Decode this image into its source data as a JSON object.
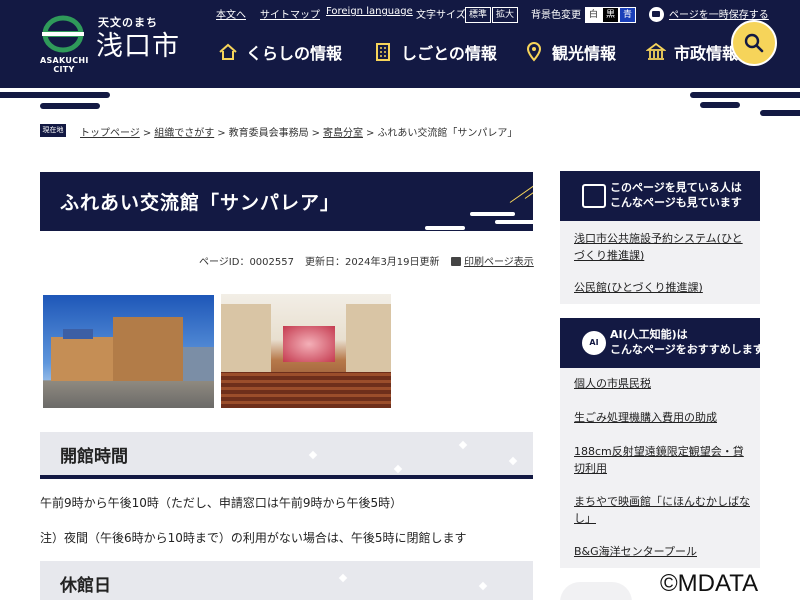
{
  "colors": {
    "navy": "#131943",
    "accent_yellow": "#f6d45a",
    "panel_gray": "#e7e8ed",
    "sidebar_bg": "#f1f1f3"
  },
  "header": {
    "logo": {
      "tagline": "天文のまち",
      "city_jp": "浅口市",
      "city_en": "ASAKUCHI CITY",
      "emblem_icon": "city-emblem-icon"
    },
    "utility": {
      "skip_to_content": "本文へ",
      "sitemap": "サイトマップ",
      "foreign_language": "Foreign language",
      "font_size_label": "文字サイズ",
      "font_size_normal": "標準",
      "font_size_large": "拡大",
      "bg_color_label": "背景色変更",
      "bg_white": "白",
      "bg_black": "黒",
      "bg_blue": "青",
      "save_page": "ページを一時保存する"
    },
    "nav": [
      {
        "label": "くらしの情報",
        "icon": "house-icon"
      },
      {
        "label": "しごとの情報",
        "icon": "building-icon"
      },
      {
        "label": "観光情報",
        "icon": "map-pin-icon"
      },
      {
        "label": "市政情報",
        "icon": "city-hall-icon"
      }
    ],
    "search_icon": "search-icon"
  },
  "breadcrumb": {
    "current_tag": "現在地",
    "items": [
      "トップページ",
      "組織でさがす",
      "教育委員会事務局",
      "寄島分室",
      "ふれあい交流館「サンパレア」"
    ]
  },
  "page": {
    "title": "ふれあい交流館「サンパレア」",
    "page_id": "ページID：0002557",
    "updated": "更新日：2024年3月19日更新",
    "print": "印刷ページ表示",
    "photos": [
      "building-exterior-photo",
      "hall-interior-photo"
    ]
  },
  "sections": {
    "hours": {
      "heading": "開館時間",
      "lines": [
        "午前9時から午後10時（ただし、申請窓口は午前9時から午後5時）",
        "注）夜間（午後6時から10時まで）の利用がない場合は、午後5時に閉館します"
      ]
    },
    "closed": {
      "heading": "休館日"
    }
  },
  "sidebar": {
    "related": {
      "heading_line1": "このページを見ている人は",
      "heading_line2": "こんなページも見ています",
      "links": [
        "浅口市公共施設予約システム(ひとづくり推進課)",
        "公民館(ひとづくり推進課)"
      ]
    },
    "ai": {
      "icon_text": "AI",
      "heading_line1": "AI(人工知能)は",
      "heading_line2": "こんなページをおすすめします",
      "links": [
        "個人の市県民税",
        "生ごみ処理機購入費用の助成",
        "188cm反射望遠鏡限定観望会・貸切利用",
        "まちやで映画館「にほんむかしばなし」",
        "B&G海洋センタープール"
      ]
    }
  },
  "watermark": "©MDATA"
}
